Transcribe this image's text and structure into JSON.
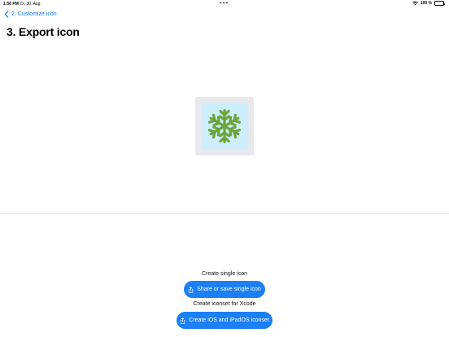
{
  "status_bar": {
    "time": "1:56 PM",
    "date": "Di. 30. Aug.",
    "multitasking_dots": "•••",
    "battery_percent": "100 %",
    "battery_level": 1.0
  },
  "nav": {
    "back_label": "2. Customize icon"
  },
  "page": {
    "title": "3. Export icon"
  },
  "icon_preview": {
    "tile_color": "#cdeefa",
    "glyph_color": "#6ba53c",
    "glyph": "snowflake-icon"
  },
  "export": {
    "single_label": "Create single icon",
    "single_button": "Share or save single icon",
    "iconset_label": "Create iconset for Xcode",
    "iconset_button": "Create iOS and iPadOS iconset"
  },
  "colors": {
    "accent": "#1b7ff6",
    "link": "#0a7aff"
  }
}
